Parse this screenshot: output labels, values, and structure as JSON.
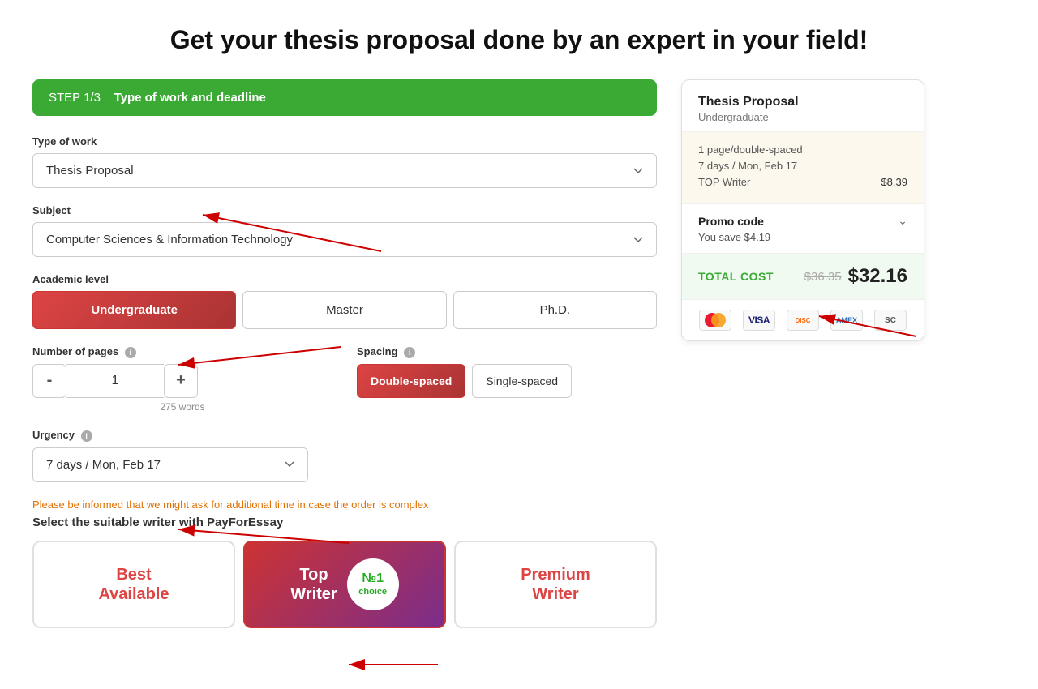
{
  "page": {
    "title": "Get your thesis proposal done by an expert in your field!"
  },
  "step": {
    "label": "STEP 1/3",
    "title": "Type of work and deadline"
  },
  "form": {
    "type_of_work_label": "Type of work",
    "type_of_work_value": "Thesis Proposal",
    "subject_label": "Subject",
    "subject_value": "Computer Sciences & Information Technology",
    "academic_level_label": "Academic level",
    "levels": [
      {
        "label": "Undergraduate",
        "active": true
      },
      {
        "label": "Master",
        "active": false
      },
      {
        "label": "Ph.D.",
        "active": false
      }
    ],
    "pages_label": "Number of pages",
    "pages_value": "1",
    "pages_words": "275 words",
    "spacing_label": "Spacing",
    "spacings": [
      {
        "label": "Double-spaced",
        "active": true
      },
      {
        "label": "Single-spaced",
        "active": false
      }
    ],
    "urgency_label": "Urgency",
    "urgency_value": "7 days / Mon, Feb 17"
  },
  "writer_section": {
    "info_text": "Please be informed that we might ask for additional time in case the order is complex",
    "title": "Select the suitable writer with PayForEssay",
    "cards": [
      {
        "label": "Best\nAvailable",
        "type": "best-available"
      },
      {
        "label": "Top\nWriter",
        "type": "top-writer",
        "badge_num": "№1",
        "badge_text": "choice"
      },
      {
        "label": "Premium\nWriter",
        "type": "premium-writer"
      }
    ]
  },
  "summary": {
    "title": "Thesis Proposal",
    "subtitle": "Undergraduate",
    "details": [
      {
        "text": "1 page/double-spaced"
      },
      {
        "text": "7 days / Mon, Feb 17"
      },
      {
        "text": "TOP Writer",
        "price": "$8.39"
      }
    ],
    "promo_label": "Promo code",
    "promo_save": "You save $4.19",
    "total_label": "TOTAL COST",
    "total_original": "$36.35",
    "total_final": "$32.16",
    "payment_icons": [
      "MC",
      "VISA",
      "DISC",
      "AMEX",
      "SC"
    ]
  }
}
